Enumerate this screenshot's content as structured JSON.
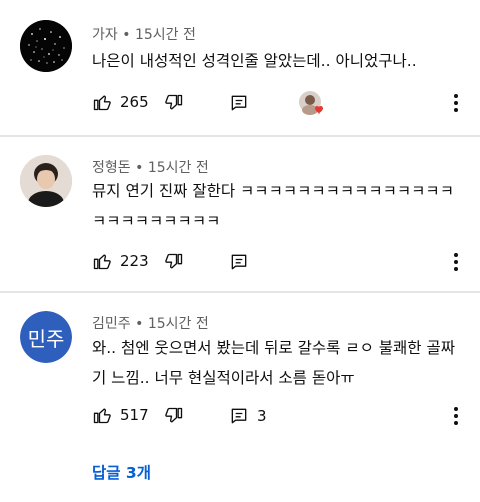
{
  "comments": [
    {
      "author": "가자",
      "time": "15시간 전",
      "text": "나은이 내성적인 성격인줄 알았는데.. 아니었구나..",
      "likes": "265",
      "avatar": "starfield"
    },
    {
      "author": "정형돈",
      "time": "15시간 전",
      "text": "뮤지 연기 진짜 잘한다 ㅋㅋㅋㅋㅋㅋㅋㅋㅋㅋㅋㅋㅋㅋㅋㅋㅋㅋㅋㅋㅋㅋㅋㅋ",
      "likes": "223",
      "avatar": "photo"
    },
    {
      "author": "김민주",
      "time": "15시간 전",
      "text": "와.. 첨엔 웃으면서 봤는데 뒤로 갈수록 ㄹㅇ 불쾌한 골짜기 느낌.. 너무 현실적이라서 소름 돋아ㅠ",
      "likes": "517",
      "reply_count": "3",
      "avatar_text": "민주",
      "avatar_color": "#2f5fbd",
      "replies_link": "답글 3개"
    }
  ],
  "icons": {
    "like": "thumbs-up-icon",
    "dislike": "thumbs-down-icon",
    "reply": "reply-icon",
    "more": "more-vertical-icon",
    "creator_heart": "creator-heart-icon"
  },
  "colors": {
    "link": "#065fd4",
    "divider": "#e5e5e5",
    "meta": "#606060"
  }
}
